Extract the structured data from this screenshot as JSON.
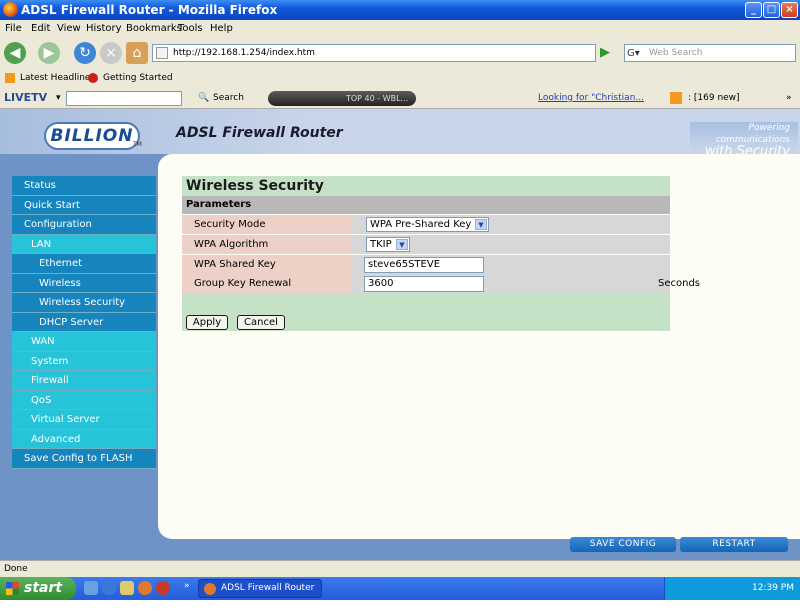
{
  "window": {
    "title": "ADSL Firewall Router - Mozilla Firefox"
  },
  "menu": [
    "File",
    "Edit",
    "View",
    "History",
    "Bookmarks",
    "Tools",
    "Help"
  ],
  "nav": {
    "url": "http://192.168.1.254/index.htm",
    "search_placeholder": "Web Search"
  },
  "bookmarks": [
    "Latest Headlines",
    "Getting Started"
  ],
  "livetv": {
    "brand": "LIVETV",
    "search_label": "Search",
    "radio_station": "TOP 40 - WBL...",
    "promo_link": "Looking for \"Christian...",
    "rss_count": ": [169 new]"
  },
  "router": {
    "logo": "BILLION",
    "logo_tm": "TM",
    "title": "ADSL Firewall Router",
    "powered_line1": "Powering communications",
    "powered_line2": "with Security"
  },
  "sidebar": {
    "items": [
      {
        "label": "Status"
      },
      {
        "label": "Quick Start"
      },
      {
        "label": "Configuration"
      },
      {
        "label": "LAN"
      },
      {
        "label": "Ethernet"
      },
      {
        "label": "Wireless"
      },
      {
        "label": "Wireless Security"
      },
      {
        "label": "DHCP Server"
      },
      {
        "label": "WAN"
      },
      {
        "label": "System"
      },
      {
        "label": "Firewall"
      },
      {
        "label": "QoS"
      },
      {
        "label": "Virtual Server"
      },
      {
        "label": "Advanced"
      },
      {
        "label": "Save Config to FLASH"
      }
    ]
  },
  "form": {
    "title": "Wireless Security",
    "section": "Parameters",
    "security_mode": {
      "label": "Security Mode",
      "value": "WPA Pre-Shared Key"
    },
    "wpa_algorithm": {
      "label": "WPA Algorithm",
      "value": "TKIP"
    },
    "wpa_shared_key": {
      "label": "WPA Shared Key",
      "value": "steve65STEVE"
    },
    "group_key_renewal": {
      "label": "Group Key Renewal",
      "value": "3600",
      "unit": "Seconds"
    },
    "apply": "Apply",
    "cancel": "Cancel"
  },
  "bottom": {
    "save_config": "SAVE CONFIG",
    "restart": "RESTART"
  },
  "status": "Done",
  "taskbar": {
    "start": "start",
    "task": "ADSL Firewall Router ...",
    "clock": "12:39 PM"
  }
}
